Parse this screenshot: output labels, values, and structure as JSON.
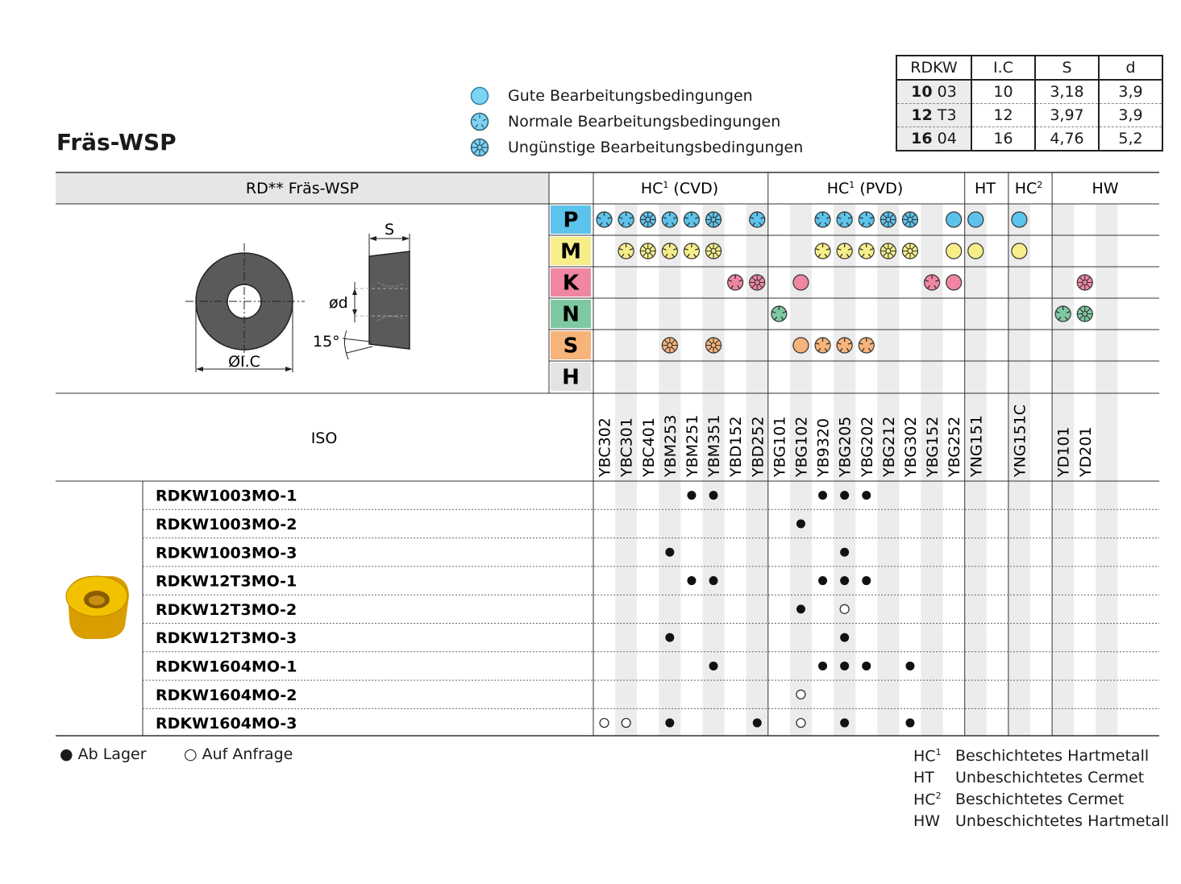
{
  "title": "Fräs-WSP",
  "legend": [
    {
      "symbol": "good",
      "label": "Gute Bearbeitungsbedingungen"
    },
    {
      "symbol": "normal",
      "label": "Normale Bearbeitungsbedingungen"
    },
    {
      "symbol": "bad",
      "label": "Ungünstige Bearbeitungsbedingungen"
    }
  ],
  "dimension_table": {
    "headers": [
      "RDKW",
      "I.C",
      "S",
      "d"
    ],
    "rows": [
      {
        "size": "10",
        "thick": "03",
        "ic": "10",
        "s": "3,18",
        "d": "3,9"
      },
      {
        "size": "12",
        "thick": "T3",
        "ic": "12",
        "s": "3,97",
        "d": "3,9"
      },
      {
        "size": "16",
        "thick": "04",
        "ic": "16",
        "s": "4,76",
        "d": "5,2"
      }
    ]
  },
  "main_header": "RD** Fräs-WSP",
  "groups": [
    {
      "label": "HC",
      "sup": "1",
      "suffix": " (CVD)"
    },
    {
      "label": "HC",
      "sup": "1",
      "suffix": " (PVD)"
    },
    {
      "label": "HT",
      "sup": "",
      "suffix": ""
    },
    {
      "label": "HC",
      "sup": "2",
      "suffix": ""
    },
    {
      "label": "HW",
      "sup": "",
      "suffix": ""
    }
  ],
  "drawing": {
    "s": "S",
    "d": "ød",
    "angle": "15°",
    "ic": "ØI.C"
  },
  "materials": [
    {
      "letter": "P",
      "color": "#5cc3ec"
    },
    {
      "letter": "M",
      "color": "#f7ee8a"
    },
    {
      "letter": "K",
      "color": "#ef86a2"
    },
    {
      "letter": "N",
      "color": "#7fc9a2"
    },
    {
      "letter": "S",
      "color": "#f6b37a"
    },
    {
      "letter": "H",
      "color": "#e3e3e3"
    }
  ],
  "iso_label": "ISO",
  "grades": [
    "YBC302",
    "YBC301",
    "YBC401",
    "YBM253",
    "YBM251",
    "YBM351",
    "YBD152",
    "YBD252",
    "YBG101",
    "YBG102",
    "YB9320",
    "YBG205",
    "YBG202",
    "YBG212",
    "YBG302",
    "YBG152",
    "YBG252",
    "YNG151",
    "",
    "YNG151C",
    "",
    "YD101",
    "YD201",
    ""
  ],
  "matrix": {
    "P": [
      "n",
      "n",
      "u",
      "n",
      "n",
      "u",
      "",
      "n",
      "",
      "",
      "n",
      "n",
      "n",
      "u",
      "u",
      "",
      "g",
      "g",
      "",
      "g",
      "",
      "",
      "",
      ""
    ],
    "M": [
      "",
      "n",
      "u",
      "n",
      "n",
      "u",
      "",
      "",
      "",
      "",
      "n",
      "n",
      "n",
      "u",
      "u",
      "",
      "g",
      "g",
      "",
      "g",
      "",
      "",
      "",
      ""
    ],
    "K": [
      "",
      "",
      "",
      "",
      "",
      "",
      "n",
      "u",
      "",
      "g",
      "",
      "",
      "",
      "",
      "",
      "n",
      "g",
      "",
      "",
      "",
      "",
      "",
      "u",
      ""
    ],
    "N": [
      "",
      "",
      "",
      "",
      "",
      "",
      "",
      "",
      "n",
      "",
      "",
      "",
      "",
      "",
      "",
      "",
      "",
      "",
      "",
      "",
      "",
      "n",
      "u",
      ""
    ],
    "S": [
      "",
      "",
      "",
      "u",
      "",
      "u",
      "",
      "",
      "",
      "g",
      "n",
      "n",
      "n",
      "",
      "",
      "",
      "",
      "",
      "",
      "",
      "",
      "",
      "",
      ""
    ],
    "H": [
      "",
      "",
      "",
      "",
      "",
      "",
      "",
      "",
      "",
      "",
      "",
      "",
      "",
      "",
      "",
      "",
      "",
      "",
      "",
      "",
      "",
      "",
      "",
      ""
    ]
  },
  "products": [
    {
      "name": "RDKW1003MO-1",
      "marks": [
        "",
        "",
        "",
        "",
        "f",
        "f",
        "",
        "",
        "",
        "",
        "f",
        "f",
        "f",
        "",
        "",
        "",
        "",
        "",
        "",
        "",
        "",
        "",
        "",
        ""
      ]
    },
    {
      "name": "RDKW1003MO-2",
      "marks": [
        "",
        "",
        "",
        "",
        "",
        "",
        "",
        "",
        "",
        "f",
        "",
        "",
        "",
        "",
        "",
        "",
        "",
        "",
        "",
        "",
        "",
        "",
        "",
        ""
      ]
    },
    {
      "name": "RDKW1003MO-3",
      "marks": [
        "",
        "",
        "",
        "f",
        "",
        "",
        "",
        "",
        "",
        "",
        "",
        "f",
        "",
        "",
        "",
        "",
        "",
        "",
        "",
        "",
        "",
        "",
        "",
        ""
      ]
    },
    {
      "name": "RDKW12T3MO-1",
      "marks": [
        "",
        "",
        "",
        "",
        "f",
        "f",
        "",
        "",
        "",
        "",
        "f",
        "f",
        "f",
        "",
        "",
        "",
        "",
        "",
        "",
        "",
        "",
        "",
        "",
        ""
      ]
    },
    {
      "name": "RDKW12T3MO-2",
      "marks": [
        "",
        "",
        "",
        "",
        "",
        "",
        "",
        "",
        "",
        "f",
        "",
        "o",
        "",
        "",
        "",
        "",
        "",
        "",
        "",
        "",
        "",
        "",
        "",
        ""
      ]
    },
    {
      "name": "RDKW12T3MO-3",
      "marks": [
        "",
        "",
        "",
        "f",
        "",
        "",
        "",
        "",
        "",
        "",
        "",
        "f",
        "",
        "",
        "",
        "",
        "",
        "",
        "",
        "",
        "",
        "",
        "",
        ""
      ]
    },
    {
      "name": "RDKW1604MO-1",
      "marks": [
        "",
        "",
        "",
        "",
        "",
        "f",
        "",
        "",
        "",
        "",
        "f",
        "f",
        "f",
        "",
        "f",
        "",
        "",
        "",
        "",
        "",
        "",
        "",
        "",
        ""
      ]
    },
    {
      "name": "RDKW1604MO-2",
      "marks": [
        "",
        "",
        "",
        "",
        "",
        "",
        "",
        "",
        "",
        "o",
        "",
        "",
        "",
        "",
        "",
        "",
        "",
        "",
        "",
        "",
        "",
        "",
        "",
        ""
      ]
    },
    {
      "name": "RDKW1604MO-3",
      "marks": [
        "o",
        "o",
        "",
        "f",
        "",
        "",
        "",
        "f",
        "",
        "o",
        "",
        "f",
        "",
        "",
        "f",
        "",
        "",
        "",
        "",
        "",
        "",
        "",
        "",
        ""
      ]
    }
  ],
  "stock_legend": {
    "in_stock": "● Ab Lager",
    "on_request": "○ Auf Anfrage"
  },
  "keys": [
    {
      "code": "HC",
      "sup": "1",
      "desc": "Beschichtetes Hartmetall"
    },
    {
      "code": "HT",
      "sup": "",
      "desc": "Unbeschichtetes Cermet"
    },
    {
      "code": "HC",
      "sup": "2",
      "desc": "Beschichtetes Cermet"
    },
    {
      "code": "HW",
      "sup": "",
      "desc": "Unbeschichtetes Hartmetall"
    }
  ]
}
